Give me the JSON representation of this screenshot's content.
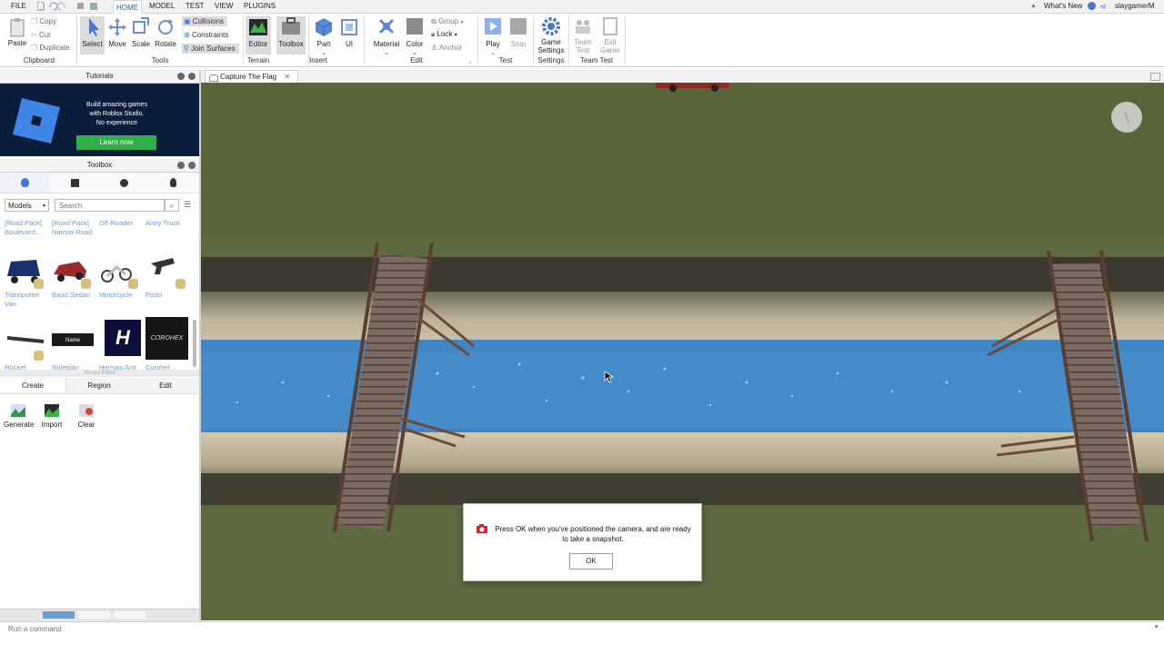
{
  "menu": {
    "file": "FILE",
    "home": "HOME",
    "model": "MODEL",
    "test": "TEST",
    "view": "VIEW",
    "plugins": "PLUGINS",
    "whats_new": "What's New",
    "user": "slaygamerM"
  },
  "ribbon": {
    "clipboard": {
      "paste": "Paste",
      "copy": "Copy",
      "cut": "Cut",
      "duplicate": "Duplicate",
      "label": "Clipboard"
    },
    "tools": {
      "select": "Select",
      "move": "Move",
      "scale": "Scale",
      "rotate": "Rotate",
      "collisions": "Collisions",
      "constraints": "Constraints",
      "join_surfaces": "Join Surfaces",
      "label": "Tools"
    },
    "terrain": {
      "editor": "Editor",
      "toolbox": "Toolbox",
      "label": "Terrain"
    },
    "insert": {
      "part": "Part",
      "ui": "UI",
      "label": "Insert"
    },
    "edit": {
      "material": "Material",
      "color": "Color",
      "group": "Group",
      "lock": "Lock",
      "anchor": "Anchor",
      "label": "Edit"
    },
    "test": {
      "play": "Play",
      "stop": "Stop",
      "label": "Test"
    },
    "settings": {
      "game_settings_1": "Game",
      "game_settings_2": "Settings",
      "label": "Settings"
    },
    "team_test": {
      "team_test_1": "Team",
      "team_test_2": "Test",
      "exit_game_1": "Exit",
      "exit_game_2": "Game",
      "label": "Team Test"
    }
  },
  "tutorials": {
    "title": "Tutorials",
    "line1": "Build amazing games",
    "line2": "with Roblox Studio.",
    "line3": "No experience",
    "learn_now": "Learn now"
  },
  "toolbox": {
    "title": "Toolbox",
    "category": "Models",
    "search_placeholder": "Search",
    "row1": [
      "[Road Pack] Boulevard...",
      "[Road Pack] Narrow Road",
      "Off-Roader",
      "Army Truck"
    ],
    "row2": [
      "Transporter Van",
      "Basic Sedan",
      "Motorcycle",
      "Pistol"
    ],
    "row3": [
      "Rocket",
      "Roleplay",
      "Hermes Anti",
      "Coroher"
    ],
    "nametag": "Name"
  },
  "terrain_editor": {
    "title": "Terrain Editor",
    "tabs": [
      "Create",
      "Region",
      "Edit"
    ],
    "tools": [
      "Generate",
      "Import",
      "Clear"
    ]
  },
  "viewport": {
    "tab": "Capture The Flag"
  },
  "dialog": {
    "message": "Press OK when you've positioned the camera, and are ready to take a snapshot.",
    "ok": "OK"
  },
  "command": {
    "placeholder": "Run a command"
  },
  "colors": {
    "accent": "#1a5fb4",
    "grass": "#5d6a40",
    "water": "#3f86c4",
    "learn_btn": "#2fae4a"
  }
}
